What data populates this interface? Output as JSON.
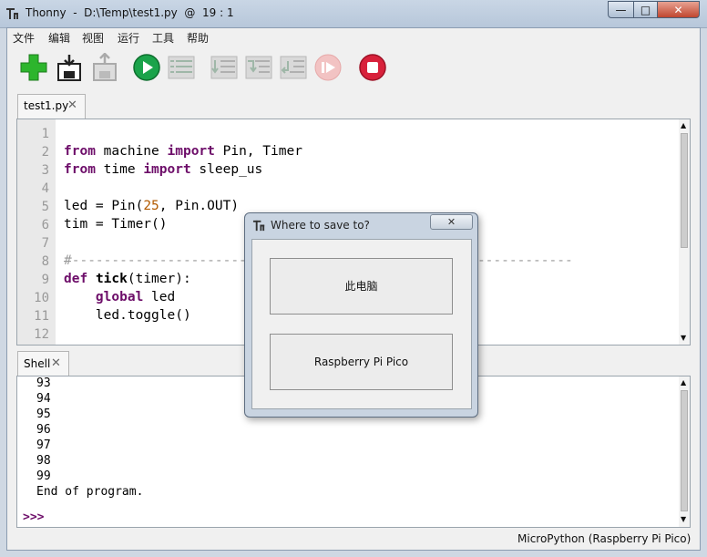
{
  "window": {
    "title": "Thonny  -  D:\\Temp\\test1.py  @  19 : 1",
    "minimize": "—",
    "maximize": "□",
    "close": "✕"
  },
  "menu": [
    "文件",
    "编辑",
    "视图",
    "运行",
    "工具",
    "帮助"
  ],
  "toolbar": {
    "icons": [
      "new-file-icon",
      "save-icon",
      "load-icon",
      "run-icon",
      "debug-icon",
      "step-over-icon",
      "step-into-icon",
      "step-out-icon",
      "resume-icon",
      "stop-icon"
    ]
  },
  "editor": {
    "tab_label": "test1.py",
    "tab_close": "✕",
    "line_numbers": [
      "1",
      "2",
      "3",
      "4",
      "5",
      "6",
      "7",
      "8",
      "9",
      "10",
      "11",
      "12"
    ],
    "lines": {
      "l2": [
        "from",
        " machine ",
        "import",
        " Pin, Timer"
      ],
      "l3": [
        "from",
        " time ",
        "import",
        " sleep_us"
      ],
      "l5a": "led = Pin(",
      "l5n": "25",
      "l5b": ", Pin.OUT)",
      "l6": "tim = Timer()",
      "l8": "#---------------------------------------------------------------",
      "l9": [
        "def",
        " ",
        "tick",
        "(timer):"
      ],
      "l10": [
        "    ",
        "global",
        " led"
      ],
      "l11": "    led.toggle()"
    }
  },
  "shell": {
    "tab_label": "Shell",
    "tab_close": "✕",
    "lines": [
      "93",
      "94",
      "95",
      "96",
      "97",
      "98",
      "99",
      "End of program."
    ],
    "prompt": ">>>"
  },
  "status": {
    "interpreter": "MicroPython (Raspberry Pi Pico)"
  },
  "dialog": {
    "title": "Where to save to?",
    "close": "✕",
    "option_this_pc": "此电脑",
    "option_pico": "Raspberry Pi Pico"
  },
  "colors": {
    "keyword": "#6d0d69",
    "number": "#b25a00",
    "comment": "#999999",
    "run_green": "#1aa34a",
    "stop_red": "#d8213b",
    "new_green": "#2db52d"
  }
}
